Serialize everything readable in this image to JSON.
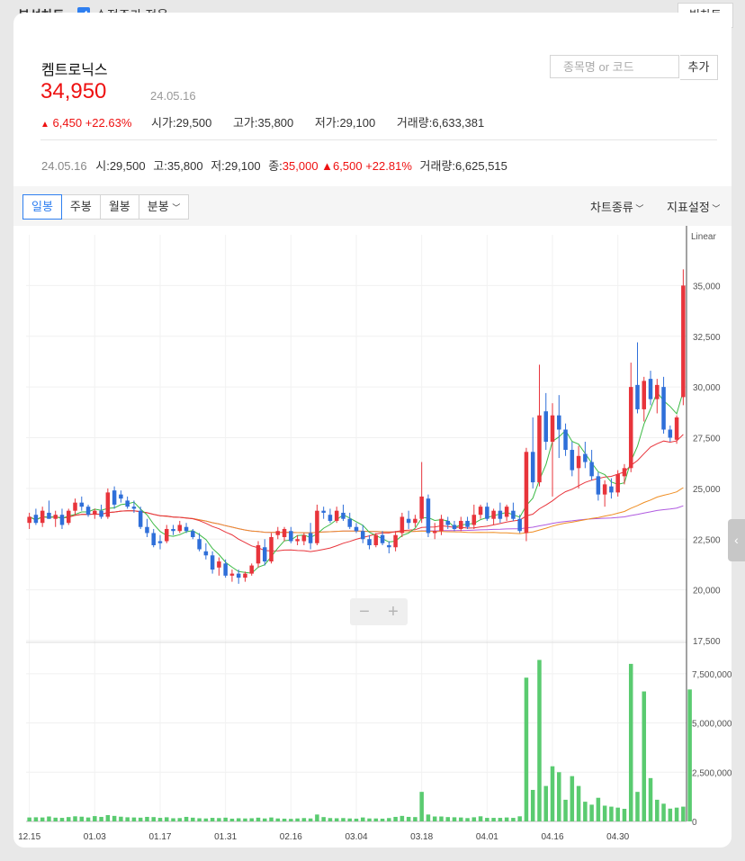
{
  "header": {
    "title": "분석차트",
    "adjusted_price_label": "수정주가 적용",
    "big_chart_button": "빅차트"
  },
  "stock": {
    "name": "켐트로닉스",
    "price": "34,950",
    "date": "24.05.16",
    "change_arrow": "▲",
    "change": "6,450",
    "change_pct": "+22.63%",
    "open_label": "시가",
    "open": "29,500",
    "high_label": "고가",
    "high": "35,800",
    "low_label": "저가",
    "low": "29,100",
    "volume_label": "거래량",
    "volume": "6,633,381"
  },
  "search": {
    "placeholder": "종목명 or 코드",
    "add_label": "추가"
  },
  "hover_row": {
    "date": "24.05.16",
    "open_label": "시",
    "open": "29,500",
    "high_label": "고",
    "high": "35,800",
    "low_label": "저",
    "low": "29,100",
    "close_label": "종",
    "close": "35,000",
    "change_arrow": "▲",
    "change": "6,500",
    "change_pct": "+22.81%",
    "volume_label": "거래량",
    "volume": "6,625,515"
  },
  "toolbar": {
    "tabs": [
      "일봉",
      "주봉",
      "월봉",
      "분봉"
    ],
    "chart_type_label": "차트종류",
    "indicator_label": "지표설정"
  },
  "zoom": {
    "minus": "−",
    "plus": "+"
  },
  "colors": {
    "up": "#e8343b",
    "down": "#2f6fd9",
    "ma5": "#3cba45",
    "ma20": "#e8343b",
    "ma60": "#ef8d22",
    "ma120": "#b05be0",
    "volume": "#5acb70"
  },
  "chart_data": {
    "type": "candlestick",
    "scale": "Linear",
    "price_ylim": [
      17500,
      37500
    ],
    "price_ticks": [
      "35,000",
      "32,500",
      "30,000",
      "27,500",
      "25,000",
      "22,500",
      "20,000",
      "17,500"
    ],
    "volume_ylim": [
      0,
      9000000
    ],
    "volume_ticks": [
      "7,500,000",
      "5,000,000",
      "2,500,000",
      "0"
    ],
    "x_ticks": [
      "12.15",
      "01.03",
      "01.17",
      "01.31",
      "02.16",
      "03.04",
      "03.18",
      "04.01",
      "04.16",
      "04.30"
    ],
    "candles": [
      {
        "date": "12.15",
        "open": 23300,
        "high": 23800,
        "low": 23000,
        "close": 23600
      },
      {
        "date": "12.18",
        "open": 23700,
        "high": 24000,
        "low": 23200,
        "close": 23300
      },
      {
        "date": "12.19",
        "open": 23300,
        "high": 24100,
        "low": 23100,
        "close": 23900
      },
      {
        "date": "12.20",
        "open": 23800,
        "high": 24400,
        "low": 23500,
        "close": 23500
      },
      {
        "date": "12.21",
        "open": 23500,
        "high": 23900,
        "low": 23100,
        "close": 23700
      },
      {
        "date": "12.22",
        "open": 23700,
        "high": 24000,
        "low": 23000,
        "close": 23200
      },
      {
        "date": "12.26",
        "open": 23300,
        "high": 24000,
        "low": 23200,
        "close": 23900
      },
      {
        "date": "12.27",
        "open": 23900,
        "high": 24500,
        "low": 23700,
        "close": 24300
      },
      {
        "date": "12.28",
        "open": 24300,
        "high": 24600,
        "low": 23900,
        "close": 24100
      },
      {
        "date": "01.02",
        "open": 24100,
        "high": 24200,
        "low": 23600,
        "close": 23700
      },
      {
        "date": "01.03",
        "open": 23700,
        "high": 24000,
        "low": 23500,
        "close": 23900
      },
      {
        "date": "01.04",
        "open": 23900,
        "high": 24200,
        "low": 23500,
        "close": 23600
      },
      {
        "date": "01.05",
        "open": 23600,
        "high": 25000,
        "low": 23500,
        "close": 24800
      },
      {
        "date": "01.08",
        "open": 24900,
        "high": 25100,
        "low": 24000,
        "close": 24200
      },
      {
        "date": "01.09",
        "open": 24700,
        "high": 24900,
        "low": 24300,
        "close": 24500
      },
      {
        "date": "01.10",
        "open": 24400,
        "high": 24600,
        "low": 24000,
        "close": 24100
      },
      {
        "date": "01.11",
        "open": 24100,
        "high": 24400,
        "low": 23800,
        "close": 24000
      },
      {
        "date": "01.12",
        "open": 23900,
        "high": 24100,
        "low": 23000,
        "close": 23100
      },
      {
        "date": "01.15",
        "open": 23100,
        "high": 23500,
        "low": 22600,
        "close": 22800
      },
      {
        "date": "01.16",
        "open": 22800,
        "high": 23000,
        "low": 22100,
        "close": 22200
      },
      {
        "date": "01.17",
        "open": 22400,
        "high": 22700,
        "low": 22000,
        "close": 22300
      },
      {
        "date": "01.18",
        "open": 22400,
        "high": 23200,
        "low": 22300,
        "close": 23000
      },
      {
        "date": "01.19",
        "open": 23000,
        "high": 23200,
        "low": 22700,
        "close": 22900
      },
      {
        "date": "01.22",
        "open": 22900,
        "high": 23400,
        "low": 22800,
        "close": 23200
      },
      {
        "date": "01.23",
        "open": 23100,
        "high": 23300,
        "low": 22800,
        "close": 22900
      },
      {
        "date": "01.24",
        "open": 22900,
        "high": 23000,
        "low": 22500,
        "close": 22600
      },
      {
        "date": "01.25",
        "open": 22500,
        "high": 22800,
        "low": 21900,
        "close": 22000
      },
      {
        "date": "01.26",
        "open": 21900,
        "high": 22300,
        "low": 21500,
        "close": 21700
      },
      {
        "date": "01.29",
        "open": 21700,
        "high": 21900,
        "low": 20800,
        "close": 21000
      },
      {
        "date": "01.30",
        "open": 21100,
        "high": 21600,
        "low": 20700,
        "close": 21400
      },
      {
        "date": "01.31",
        "open": 21300,
        "high": 21500,
        "low": 20600,
        "close": 20700
      },
      {
        "date": "02.01",
        "open": 20700,
        "high": 21000,
        "low": 20400,
        "close": 20800
      },
      {
        "date": "02.02",
        "open": 20800,
        "high": 21000,
        "low": 20300,
        "close": 20600
      },
      {
        "date": "02.05",
        "open": 20600,
        "high": 20900,
        "low": 20400,
        "close": 20800
      },
      {
        "date": "02.06",
        "open": 20800,
        "high": 21300,
        "low": 20700,
        "close": 21200
      },
      {
        "date": "02.07",
        "open": 21300,
        "high": 22400,
        "low": 21100,
        "close": 22200
      },
      {
        "date": "02.08",
        "open": 22100,
        "high": 22500,
        "low": 21200,
        "close": 21400
      },
      {
        "date": "02.13",
        "open": 21400,
        "high": 22800,
        "low": 21300,
        "close": 22600
      },
      {
        "date": "02.14",
        "open": 22700,
        "high": 23100,
        "low": 22500,
        "close": 22900
      },
      {
        "date": "02.15",
        "open": 22600,
        "high": 23100,
        "low": 22400,
        "close": 23000
      },
      {
        "date": "02.16",
        "open": 22900,
        "high": 23100,
        "low": 22300,
        "close": 22400
      },
      {
        "date": "02.19",
        "open": 22400,
        "high": 22700,
        "low": 22200,
        "close": 22500
      },
      {
        "date": "02.20",
        "open": 22400,
        "high": 22800,
        "low": 22200,
        "close": 22700
      },
      {
        "date": "02.21",
        "open": 22800,
        "high": 23300,
        "low": 22000,
        "close": 22300
      },
      {
        "date": "02.22",
        "open": 22300,
        "high": 24200,
        "low": 22200,
        "close": 23900
      },
      {
        "date": "02.23",
        "open": 23900,
        "high": 24100,
        "low": 23500,
        "close": 23800
      },
      {
        "date": "02.26",
        "open": 23700,
        "high": 24000,
        "low": 23300,
        "close": 23400
      },
      {
        "date": "02.27",
        "open": 23400,
        "high": 24100,
        "low": 23300,
        "close": 23900
      },
      {
        "date": "02.28",
        "open": 23800,
        "high": 24200,
        "low": 23400,
        "close": 23500
      },
      {
        "date": "02.29",
        "open": 23500,
        "high": 23800,
        "low": 23000,
        "close": 23100
      },
      {
        "date": "03.04",
        "open": 23100,
        "high": 23300,
        "low": 22800,
        "close": 22900
      },
      {
        "date": "03.05",
        "open": 22900,
        "high": 23200,
        "low": 22300,
        "close": 22500
      },
      {
        "date": "03.06",
        "open": 22500,
        "high": 22700,
        "low": 22000,
        "close": 22200
      },
      {
        "date": "03.07",
        "open": 22200,
        "high": 22800,
        "low": 22100,
        "close": 22700
      },
      {
        "date": "03.08",
        "open": 22700,
        "high": 22900,
        "low": 22200,
        "close": 22300
      },
      {
        "date": "03.11",
        "open": 22200,
        "high": 22400,
        "low": 21800,
        "close": 22100
      },
      {
        "date": "03.12",
        "open": 22100,
        "high": 22900,
        "low": 21900,
        "close": 22700
      },
      {
        "date": "03.13",
        "open": 22800,
        "high": 23800,
        "low": 22600,
        "close": 23600
      },
      {
        "date": "03.14",
        "open": 23500,
        "high": 23900,
        "low": 23000,
        "close": 23300
      },
      {
        "date": "03.15",
        "open": 23300,
        "high": 23700,
        "low": 23100,
        "close": 23500
      },
      {
        "date": "03.18",
        "open": 23500,
        "high": 26300,
        "low": 23300,
        "close": 24600
      },
      {
        "date": "03.19",
        "open": 24500,
        "high": 24700,
        "low": 22600,
        "close": 22800
      },
      {
        "date": "03.20",
        "open": 22800,
        "high": 23300,
        "low": 22500,
        "close": 22900
      },
      {
        "date": "03.21",
        "open": 22900,
        "high": 23700,
        "low": 22700,
        "close": 23500
      },
      {
        "date": "03.22",
        "open": 23400,
        "high": 23600,
        "low": 23000,
        "close": 23200
      },
      {
        "date": "03.25",
        "open": 23200,
        "high": 23400,
        "low": 22900,
        "close": 23000
      },
      {
        "date": "03.26",
        "open": 23000,
        "high": 23600,
        "low": 22900,
        "close": 23400
      },
      {
        "date": "03.27",
        "open": 23400,
        "high": 23600,
        "low": 23000,
        "close": 23100
      },
      {
        "date": "03.28",
        "open": 23200,
        "high": 24200,
        "low": 23000,
        "close": 23700
      },
      {
        "date": "03.29",
        "open": 23700,
        "high": 24200,
        "low": 23500,
        "close": 24100
      },
      {
        "date": "04.01",
        "open": 24100,
        "high": 24300,
        "low": 23400,
        "close": 23500
      },
      {
        "date": "04.02",
        "open": 23500,
        "high": 24000,
        "low": 23200,
        "close": 23900
      },
      {
        "date": "04.03",
        "open": 23900,
        "high": 24300,
        "low": 23300,
        "close": 23500
      },
      {
        "date": "04.04",
        "open": 23600,
        "high": 24200,
        "low": 23400,
        "close": 24100
      },
      {
        "date": "04.05",
        "open": 23900,
        "high": 24300,
        "low": 23400,
        "close": 23500
      },
      {
        "date": "04.08",
        "open": 23500,
        "high": 23700,
        "low": 22800,
        "close": 22900
      },
      {
        "date": "04.09",
        "open": 22800,
        "high": 27000,
        "low": 22400,
        "close": 26800
      },
      {
        "date": "04.11",
        "open": 26800,
        "high": 28500,
        "low": 25000,
        "close": 25300
      },
      {
        "date": "04.12",
        "open": 25300,
        "high": 31100,
        "low": 25100,
        "close": 28600
      },
      {
        "date": "04.15",
        "open": 28800,
        "high": 29700,
        "low": 26900,
        "close": 27300
      },
      {
        "date": "04.16",
        "open": 27300,
        "high": 29200,
        "low": 24600,
        "close": 28600
      },
      {
        "date": "04.17",
        "open": 28600,
        "high": 29600,
        "low": 26500,
        "close": 27900
      },
      {
        "date": "04.18",
        "open": 27900,
        "high": 28200,
        "low": 26600,
        "close": 26900
      },
      {
        "date": "04.19",
        "open": 26900,
        "high": 27300,
        "low": 25600,
        "close": 25900
      },
      {
        "date": "04.22",
        "open": 26000,
        "high": 27100,
        "low": 25000,
        "close": 26600
      },
      {
        "date": "04.23",
        "open": 26700,
        "high": 27300,
        "low": 26000,
        "close": 26300
      },
      {
        "date": "04.24",
        "open": 26300,
        "high": 26900,
        "low": 25400,
        "close": 25600
      },
      {
        "date": "04.25",
        "open": 25600,
        "high": 25800,
        "low": 24400,
        "close": 24700
      },
      {
        "date": "04.26",
        "open": 24700,
        "high": 25400,
        "low": 24100,
        "close": 25200
      },
      {
        "date": "04.29",
        "open": 25100,
        "high": 25500,
        "low": 24500,
        "close": 24800
      },
      {
        "date": "04.30",
        "open": 24800,
        "high": 25900,
        "low": 24600,
        "close": 25700
      },
      {
        "date": "05.02",
        "open": 25600,
        "high": 26200,
        "low": 25200,
        "close": 26000
      },
      {
        "date": "05.03",
        "open": 26000,
        "high": 31200,
        "low": 25800,
        "close": 30000
      },
      {
        "date": "05.07",
        "open": 30100,
        "high": 32200,
        "low": 28700,
        "close": 28900
      },
      {
        "date": "05.08",
        "open": 28900,
        "high": 30500,
        "low": 28300,
        "close": 30300
      },
      {
        "date": "05.09",
        "open": 30400,
        "high": 30800,
        "low": 29100,
        "close": 29400
      },
      {
        "date": "05.10",
        "open": 29400,
        "high": 30400,
        "low": 28700,
        "close": 30100
      },
      {
        "date": "05.13",
        "open": 30000,
        "high": 30500,
        "low": 27700,
        "close": 27900
      },
      {
        "date": "05.14",
        "open": 27900,
        "high": 28100,
        "low": 27300,
        "close": 27500
      },
      {
        "date": "05.15",
        "open": 27400,
        "high": 28600,
        "low": 27200,
        "close": 28500
      },
      {
        "date": "05.16",
        "open": 29500,
        "high": 35800,
        "low": 29100,
        "close": 35000
      }
    ],
    "volumes": [
      200000,
      210000,
      200000,
      250000,
      190000,
      180000,
      220000,
      260000,
      240000,
      200000,
      270000,
      230000,
      320000,
      280000,
      240000,
      210000,
      200000,
      190000,
      230000,
      220000,
      180000,
      210000,
      160000,
      170000,
      230000,
      190000,
      160000,
      150000,
      180000,
      170000,
      190000,
      140000,
      160000,
      150000,
      160000,
      190000,
      150000,
      200000,
      150000,
      140000,
      130000,
      150000,
      170000,
      150000,
      350000,
      220000,
      170000,
      160000,
      170000,
      150000,
      140000,
      200000,
      150000,
      150000,
      140000,
      170000,
      230000,
      280000,
      230000,
      220000,
      1500000,
      350000,
      250000,
      250000,
      220000,
      210000,
      200000,
      170000,
      210000,
      260000,
      180000,
      180000,
      180000,
      200000,
      180000,
      260000,
      7300000,
      1600000,
      8200000,
      1800000,
      2800000,
      2500000,
      1100000,
      2300000,
      1800000,
      1000000,
      850000,
      1200000,
      800000,
      750000,
      700000,
      640000,
      8000000,
      1500000,
      6600000,
      2200000,
      1100000,
      900000,
      650000,
      700000,
      750000,
      6700000
    ]
  }
}
